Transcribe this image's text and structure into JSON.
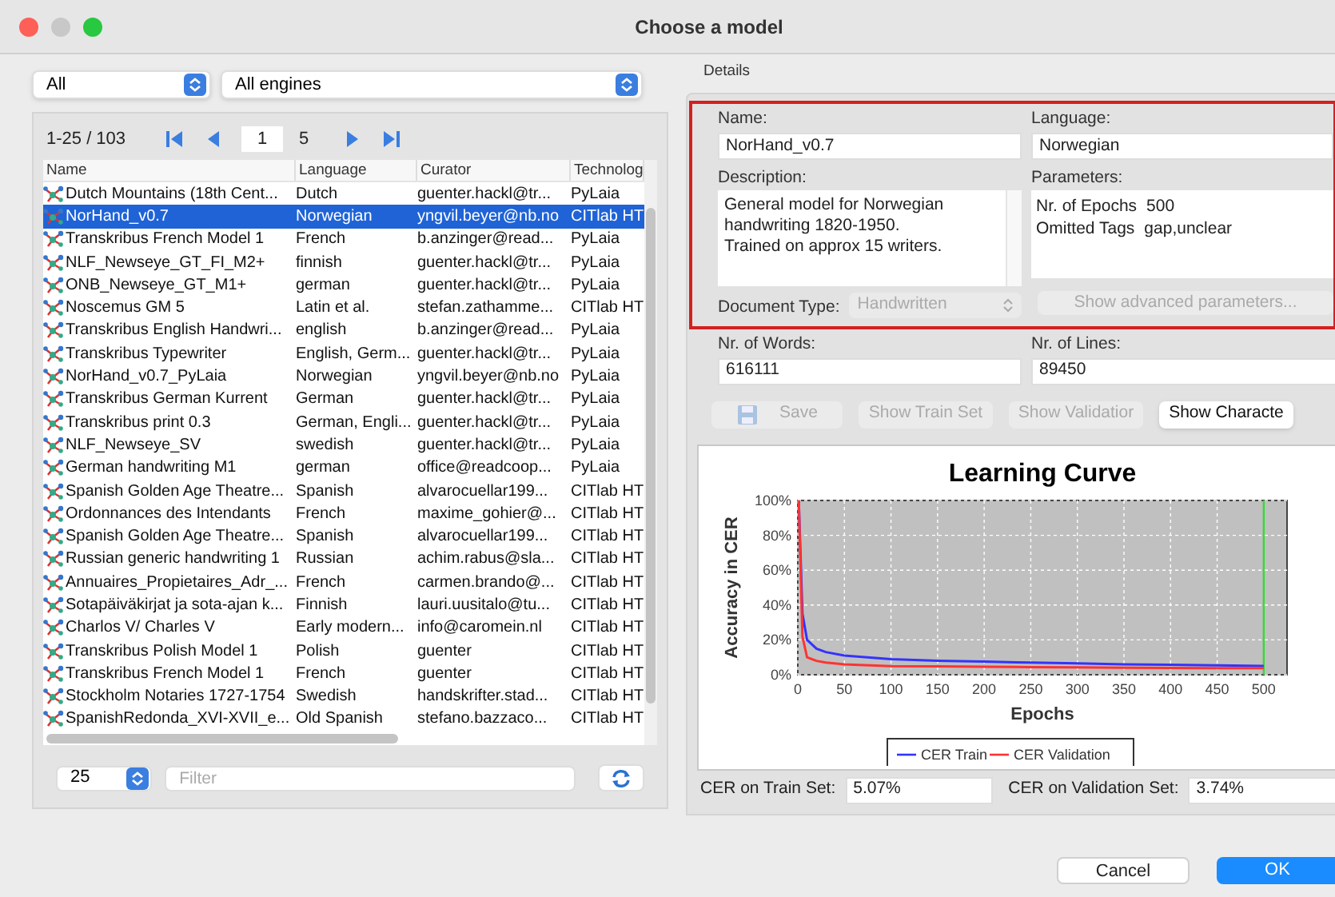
{
  "window": {
    "title": "Choose a model"
  },
  "filters": {
    "type": "All",
    "engine": "All engines"
  },
  "pager": {
    "range": "1-25 / 103",
    "page": "1",
    "pages": "5"
  },
  "table": {
    "columns": [
      "Name",
      "Language",
      "Curator",
      "Technolog"
    ],
    "rows": [
      {
        "cells": [
          "Dutch Mountains (18th Cent...",
          "Dutch",
          "guenter.hackl@tr...",
          "PyLaia"
        ],
        "selected": false
      },
      {
        "cells": [
          "NorHand_v0.7",
          "Norwegian",
          "yngvil.beyer@nb.no",
          "CITlab HT"
        ],
        "selected": true
      },
      {
        "cells": [
          "Transkribus French Model 1",
          "French",
          "b.anzinger@read...",
          "PyLaia"
        ],
        "selected": false
      },
      {
        "cells": [
          "NLF_Newseye_GT_FI_M2+",
          "finnish",
          "guenter.hackl@tr...",
          "PyLaia"
        ],
        "selected": false
      },
      {
        "cells": [
          "ONB_Newseye_GT_M1+",
          "german",
          "guenter.hackl@tr...",
          "PyLaia"
        ],
        "selected": false
      },
      {
        "cells": [
          "Noscemus GM 5",
          "Latin et al.",
          "stefan.zathamme...",
          "CITlab HT"
        ],
        "selected": false
      },
      {
        "cells": [
          "Transkribus English Handwri...",
          "english",
          "b.anzinger@read...",
          "PyLaia"
        ],
        "selected": false
      },
      {
        "cells": [
          "Transkribus Typewriter",
          "English, Germ...",
          "guenter.hackl@tr...",
          "PyLaia"
        ],
        "selected": false
      },
      {
        "cells": [
          "NorHand_v0.7_PyLaia",
          "Norwegian",
          "yngvil.beyer@nb.no",
          "PyLaia"
        ],
        "selected": false
      },
      {
        "cells": [
          "Transkribus German Kurrent",
          "German",
          "guenter.hackl@tr...",
          "PyLaia"
        ],
        "selected": false
      },
      {
        "cells": [
          "Transkribus print 0.3",
          "German, Engli...",
          "guenter.hackl@tr...",
          "PyLaia"
        ],
        "selected": false
      },
      {
        "cells": [
          "NLF_Newseye_SV",
          "swedish",
          "guenter.hackl@tr...",
          "PyLaia"
        ],
        "selected": false
      },
      {
        "cells": [
          "German handwriting M1",
          "german",
          "office@readcoop...",
          "PyLaia"
        ],
        "selected": false
      },
      {
        "cells": [
          "Spanish Golden Age Theatre...",
          "Spanish",
          "alvarocuellar199...",
          "CITlab HT"
        ],
        "selected": false
      },
      {
        "cells": [
          "Ordonnances des Intendants",
          "French",
          "maxime_gohier@...",
          "CITlab HT"
        ],
        "selected": false
      },
      {
        "cells": [
          "Spanish Golden Age Theatre...",
          "Spanish",
          "alvarocuellar199...",
          "CITlab HT"
        ],
        "selected": false
      },
      {
        "cells": [
          "Russian generic handwriting 1",
          "Russian",
          "achim.rabus@sla...",
          "CITlab HT"
        ],
        "selected": false
      },
      {
        "cells": [
          "Annuaires_Propietaires_Adr_...",
          "French",
          "carmen.brando@...",
          "CITlab HT"
        ],
        "selected": false
      },
      {
        "cells": [
          "Sotapäiväkirjat ja sota-ajan k...",
          "Finnish",
          "lauri.uusitalo@tu...",
          "CITlab HT"
        ],
        "selected": false
      },
      {
        "cells": [
          "Charlos V/ Charles V",
          "Early modern...",
          "info@caromein.nl",
          "CITlab HT"
        ],
        "selected": false
      },
      {
        "cells": [
          "Transkribus Polish Model 1",
          "Polish",
          "guenter",
          "CITlab HT"
        ],
        "selected": false
      },
      {
        "cells": [
          "Transkribus French Model 1",
          "French",
          "guenter",
          "CITlab HT"
        ],
        "selected": false
      },
      {
        "cells": [
          "Stockholm Notaries 1727-1754",
          "Swedish",
          "handskrifter.stad...",
          "CITlab HT"
        ],
        "selected": false
      },
      {
        "cells": [
          "SpanishRedonda_XVI-XVII_e...",
          "Old Spanish",
          "stefano.bazzaco...",
          "CITlab HT"
        ],
        "selected": false
      }
    ]
  },
  "page_size": "25",
  "filter": {
    "placeholder": "Filter"
  },
  "details": {
    "title": "Details",
    "name_label": "Name:",
    "name": "NorHand_v0.7",
    "language_label": "Language:",
    "language": "Norwegian",
    "description_label": "Description:",
    "description": [
      "General model for Norwegian",
      "handwriting 1820-1950.",
      "Trained on approx 15 writers."
    ],
    "parameters_label": "Parameters:",
    "parameters": [
      {
        "key": "Nr. of Epochs",
        "value": "500"
      },
      {
        "key": "Omitted Tags",
        "value": "gap,unclear"
      }
    ],
    "doc_type_label": "Document Type:",
    "doc_type": "Handwritten",
    "doc_type_disabled": true,
    "advanced": {
      "label": "Show advanced parameters...",
      "disabled": true
    },
    "words_label": "Nr. of Words:",
    "words": "616111",
    "lines_label": "Nr. of Lines:",
    "lines": "89450",
    "buttons": [
      {
        "label": "Save",
        "disabled": true,
        "kind": "save"
      },
      {
        "label": "Show Train Set",
        "disabled": true,
        "kind": "plain"
      },
      {
        "label": "Show Validatior",
        "disabled": true,
        "kind": "plain"
      },
      {
        "label": "Show Characte",
        "disabled": false,
        "kind": "plain"
      }
    ],
    "chart_data": {
      "type": "line",
      "title": "Learning Curve",
      "xlabel": "Epochs",
      "ylabel": "Accuracy in CER",
      "x": [
        1,
        5,
        10,
        20,
        30,
        50,
        100,
        150,
        200,
        250,
        300,
        350,
        400,
        450,
        500
      ],
      "series": [
        {
          "name": "CER Train",
          "color": "#3333ff",
          "values": [
            100,
            35,
            20,
            15,
            13,
            11,
            9,
            8,
            7.5,
            7,
            6.5,
            6,
            5.8,
            5.4,
            5.07
          ]
        },
        {
          "name": "CER Validation",
          "color": "#ff3333",
          "values": [
            100,
            22,
            10,
            8,
            7,
            6,
            5,
            4.8,
            4.6,
            4.4,
            4.2,
            4,
            3.9,
            3.8,
            3.74
          ]
        }
      ],
      "xlim": [
        0,
        525
      ],
      "ylim": [
        0,
        100
      ],
      "xticks": [
        0,
        50,
        100,
        150,
        200,
        250,
        300,
        350,
        400,
        450,
        500
      ],
      "yticks": [
        {
          "value": 0,
          "label": "0%"
        },
        {
          "value": 20,
          "label": "20%"
        },
        {
          "value": 40,
          "label": "40%"
        },
        {
          "value": 60,
          "label": "60%"
        },
        {
          "value": 80,
          "label": "80%"
        },
        {
          "value": 100,
          "label": "100%"
        }
      ],
      "grid": true,
      "legend": true,
      "ref_lines": [
        {
          "axis": "x",
          "value": 500,
          "color": "#33dd33"
        }
      ]
    },
    "cer_train_label": "CER on Train Set:",
    "cer_train": "5.07%",
    "cer_val_label": "CER on Validation Set:",
    "cer_val": "3.74%"
  },
  "footer": {
    "cancel": "Cancel",
    "ok": "OK"
  }
}
